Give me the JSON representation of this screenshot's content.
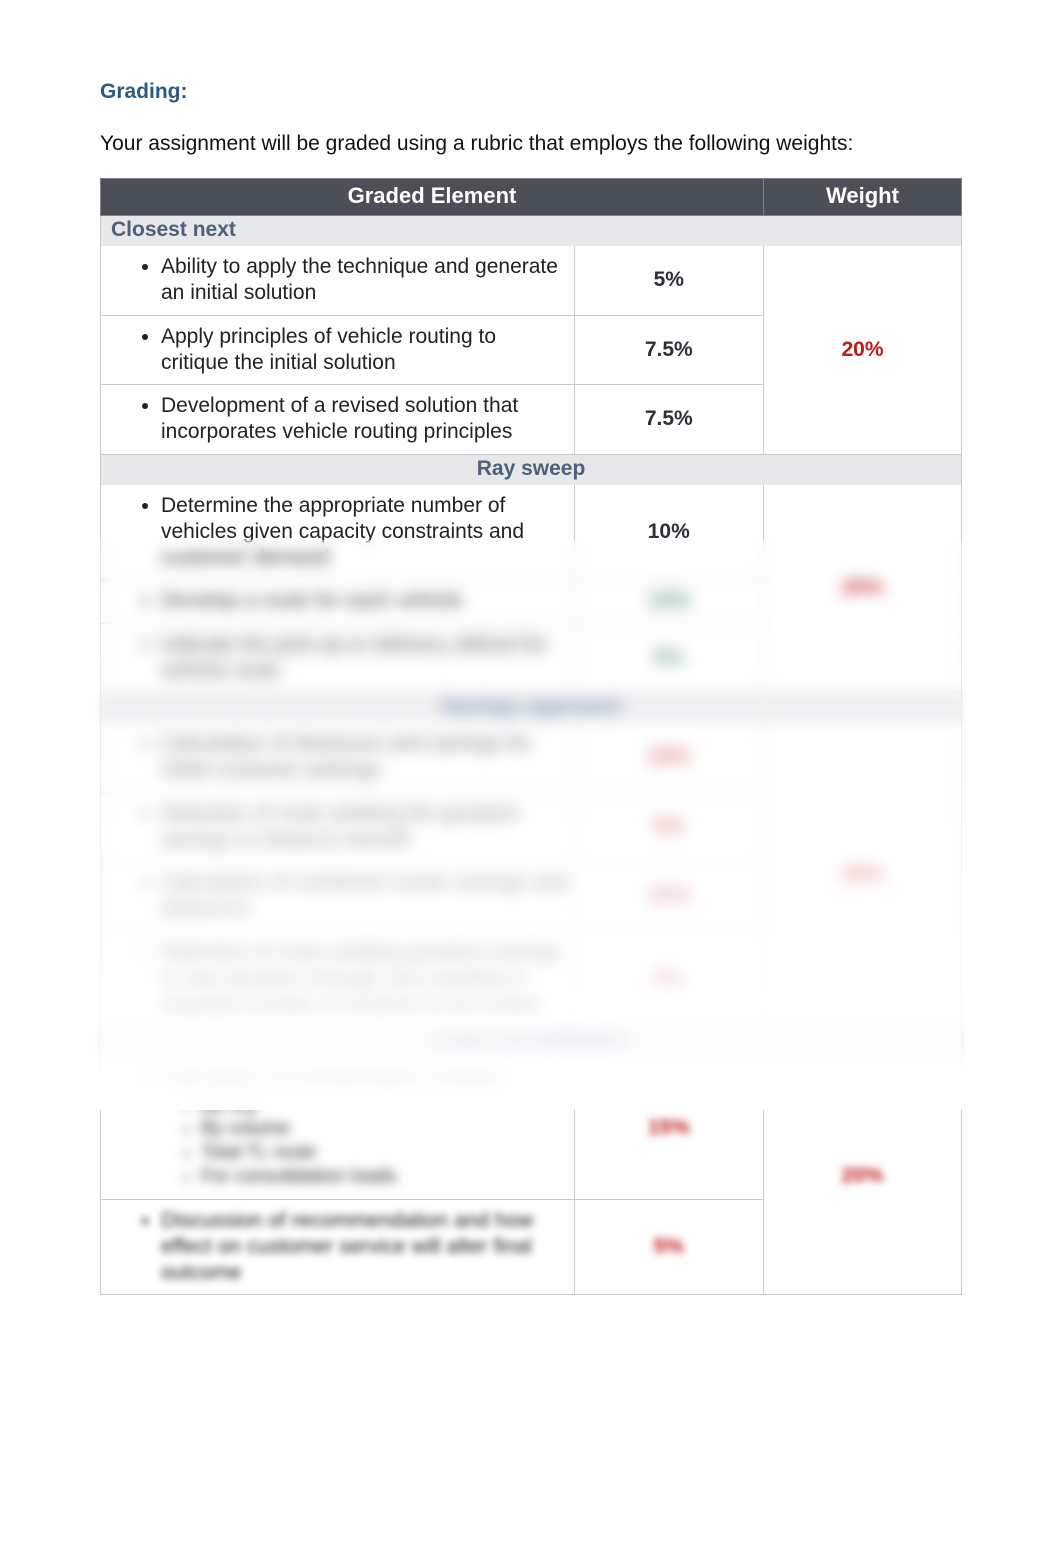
{
  "heading": "Grading:",
  "intro": "Your assignment will be graded using a rubric that employs the following weights:",
  "table": {
    "header": {
      "element": "Graded Element",
      "weight": "Weight"
    },
    "sections": [
      {
        "title": "Closest next",
        "title_align": "left",
        "total": "20%",
        "items": [
          {
            "text": "Ability to apply the technique and generate an initial solution",
            "pct": "5%"
          },
          {
            "text": "Apply principles of vehicle routing to critique the initial solution",
            "pct": "7.5%"
          },
          {
            "text": "Development of a revised solution that incorporates vehicle routing principles",
            "pct": "7.5%"
          }
        ]
      },
      {
        "title": "Ray sweep",
        "title_align": "center",
        "total": "25%",
        "items": [
          {
            "text": "Determine the appropriate number of vehicles given capacity constraints and customer demand",
            "pct": "10%"
          },
          {
            "text": "Develop a route for each vehicle",
            "pct": "10%",
            "pct_blur": true
          },
          {
            "text": "Indicate the pick-up or delivery utilized for vehicle route",
            "pct": "5%",
            "blur": true
          }
        ]
      },
      {
        "title": "Savings approach",
        "title_align": "center",
        "blur": true,
        "total": "30%",
        "items": [
          {
            "text": "Calculation of distances and savings for initial customer pairings",
            "pct": "10%",
            "blur": true
          },
          {
            "text": "Selection of route yielding the greatest savings or distance benefit",
            "pct": "5%",
            "blur": true
          },
          {
            "text": "Calculation of combined routes savings and distances",
            "pct": "10%",
            "blur": true
          },
          {
            "text": "Selection of route yielding greatest savings in new iteration through and resulting in required number of vehicles to be routed",
            "pct": "5%",
            "blur": true
          }
        ]
      },
      {
        "title": "Load consolidation",
        "title_align": "center",
        "blur": true,
        "total": "20%",
        "items": [
          {
            "text": "Calculation of transportation charges",
            "subs": [
              "By city",
              "By volume",
              "Total TL route",
              "For consolidation loads"
            ],
            "pct": "15%",
            "blur": true
          },
          {
            "text": "Discussion of recommendation and how effect on customer service will alter final outcome",
            "pct": "5%",
            "blur": true
          }
        ]
      }
    ]
  }
}
